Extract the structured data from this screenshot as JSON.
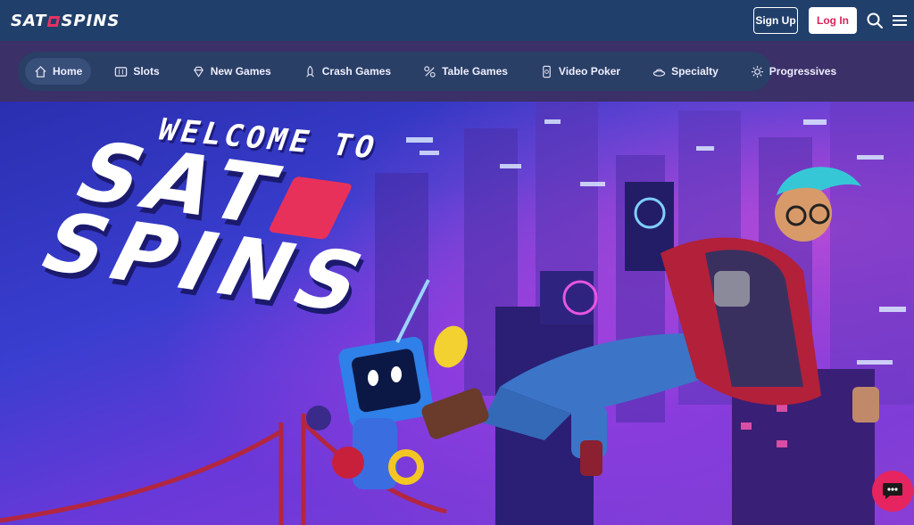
{
  "header": {
    "logo": {
      "left": "SAT",
      "right": "SPINS"
    },
    "signup_label": "Sign Up",
    "login_label": "Log In",
    "colors": {
      "bar": "#213f6b",
      "accent": "#e6245f"
    }
  },
  "nav": {
    "items": [
      {
        "label": "Home",
        "icon": "home-icon",
        "active": true
      },
      {
        "label": "Slots",
        "icon": "slot-machine-icon"
      },
      {
        "label": "New Games",
        "icon": "diamond-icon"
      },
      {
        "label": "Crash Games",
        "icon": "rocket-icon"
      },
      {
        "label": "Table Games",
        "icon": "cards-icon"
      },
      {
        "label": "Video Poker",
        "icon": "poker-chip-icon"
      },
      {
        "label": "Specialty",
        "icon": "specialty-icon"
      },
      {
        "label": "Progressives",
        "icon": "sparkle-icon"
      }
    ]
  },
  "hero": {
    "line1": "WELCOME TO",
    "line2a": "SAT",
    "line3": "SPINS"
  }
}
